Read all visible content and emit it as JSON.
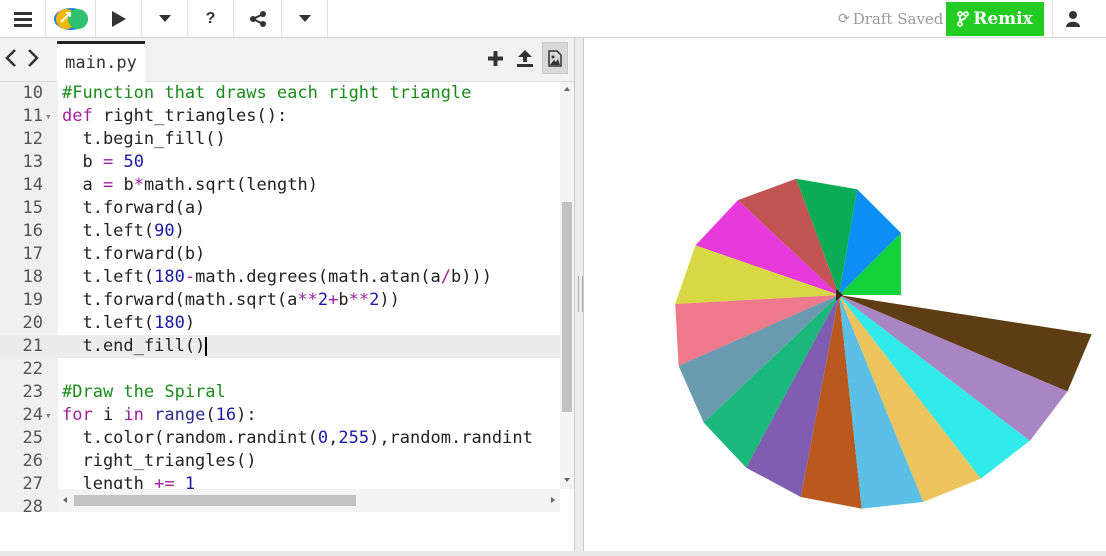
{
  "toolbar": {
    "draft_label": "Draft Saved",
    "remix_label": "Remix",
    "remix_color": "#22cc22"
  },
  "tabs": {
    "active_file": "main.py"
  },
  "code_lines": [
    {
      "n": "10",
      "text": "#Function that draws each right triangle"
    },
    {
      "n": "11",
      "text": "def right_triangles():"
    },
    {
      "n": "12",
      "text": "  t.begin_fill()"
    },
    {
      "n": "13",
      "text": "  b = 50"
    },
    {
      "n": "14",
      "text": "  a = b*math.sqrt(length)"
    },
    {
      "n": "15",
      "text": "  t.forward(a)"
    },
    {
      "n": "16",
      "text": "  t.left(90)"
    },
    {
      "n": "17",
      "text": "  t.forward(b)"
    },
    {
      "n": "18",
      "text": "  t.left(180-math.degrees(math.atan(a/b)))"
    },
    {
      "n": "19",
      "text": "  t.forward(math.sqrt(a**2+b**2))"
    },
    {
      "n": "20",
      "text": "  t.left(180)"
    },
    {
      "n": "21",
      "text": "  t.end_fill()"
    },
    {
      "n": "22",
      "text": ""
    },
    {
      "n": "23",
      "text": "#Draw the Spiral"
    },
    {
      "n": "24",
      "text": "for i in range(16):"
    },
    {
      "n": "25",
      "text": "  t.color(random.randint(0,255),random.randint"
    },
    {
      "n": "26",
      "text": "  right_triangles()"
    },
    {
      "n": "27",
      "text": "  length += 1"
    },
    {
      "n": "28",
      "text": ""
    }
  ],
  "spiral_colors": [
    "#14d23c",
    "#0b8ef5",
    "#0aad55",
    "#c25454",
    "#e63adb",
    "#d8d845",
    "#ef7a8c",
    "#6a9aae",
    "#1ab87a",
    "#7f5eb2",
    "#b9591f",
    "#5bbfe6",
    "#eec45f",
    "#33eaea",
    "#a986c3",
    "#5e3d14"
  ]
}
